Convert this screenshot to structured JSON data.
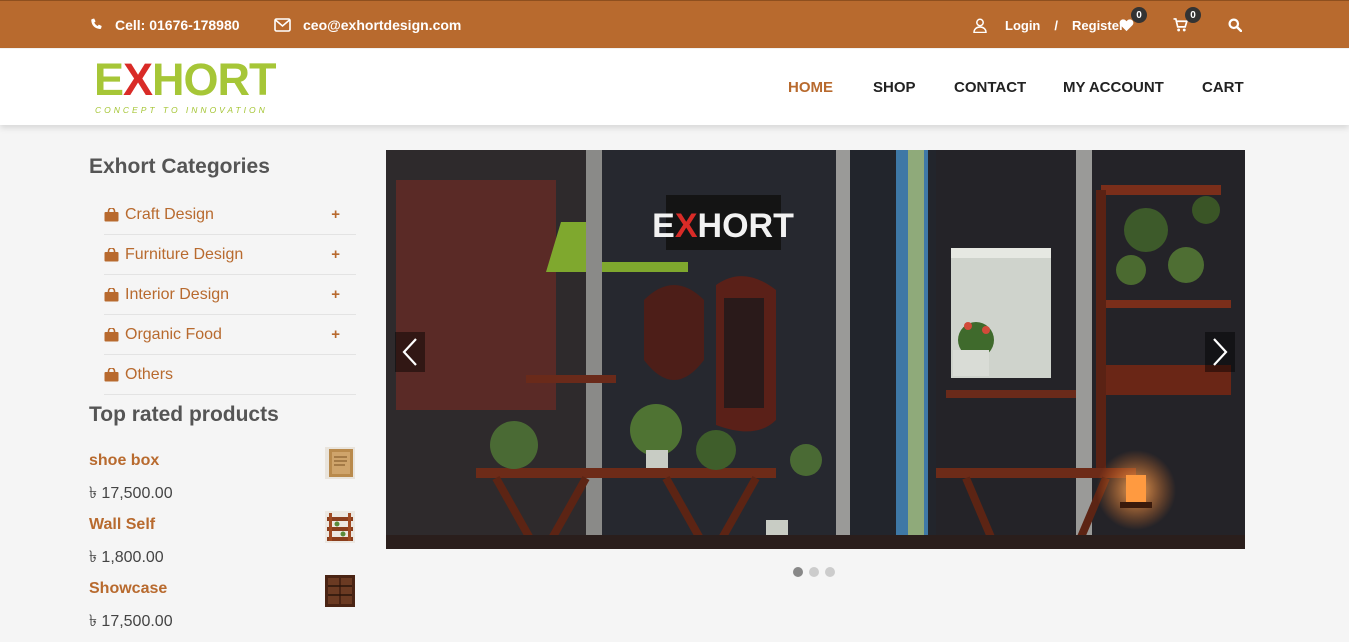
{
  "topbar": {
    "phone": "Cell: 01676-178980",
    "email": "ceo@exhortdesign.com",
    "login": "Login",
    "separator": "/",
    "register": "Register",
    "wishlist_count": "0",
    "cart_count": "0"
  },
  "logo": {
    "word_start": "E",
    "word_x": "X",
    "word_end": "HORT",
    "tagline": "CONCEPT TO INNOVATION"
  },
  "nav": {
    "home": "HOME",
    "shop": "SHOP",
    "contact": "CONTACT",
    "account": "MY ACCOUNT",
    "cart": "CART"
  },
  "sidebar": {
    "categories_title": "Exhort Categories",
    "categories": [
      {
        "label": "Craft Design",
        "expand": "+"
      },
      {
        "label": "Furniture Design",
        "expand": "+"
      },
      {
        "label": "Interior Design",
        "expand": "+"
      },
      {
        "label": "Organic Food",
        "expand": "+"
      },
      {
        "label": "Others",
        "expand": ""
      }
    ],
    "top_rated_title": "Top rated products",
    "products": [
      {
        "name": "shoe box",
        "price": "৳ 17,500.00"
      },
      {
        "name": "Wall Self",
        "price": "৳ 1,800.00"
      },
      {
        "name": "Showcase",
        "price": "৳ 17,500.00"
      }
    ]
  },
  "slider": {
    "sign_start": "E",
    "sign_x": "X",
    "sign_end": "HORT",
    "slide_count": 3,
    "active_slide": 1
  },
  "colors": {
    "brand_brown": "#b86a2e",
    "logo_green": "#a6c637",
    "logo_red": "#d92b27"
  }
}
